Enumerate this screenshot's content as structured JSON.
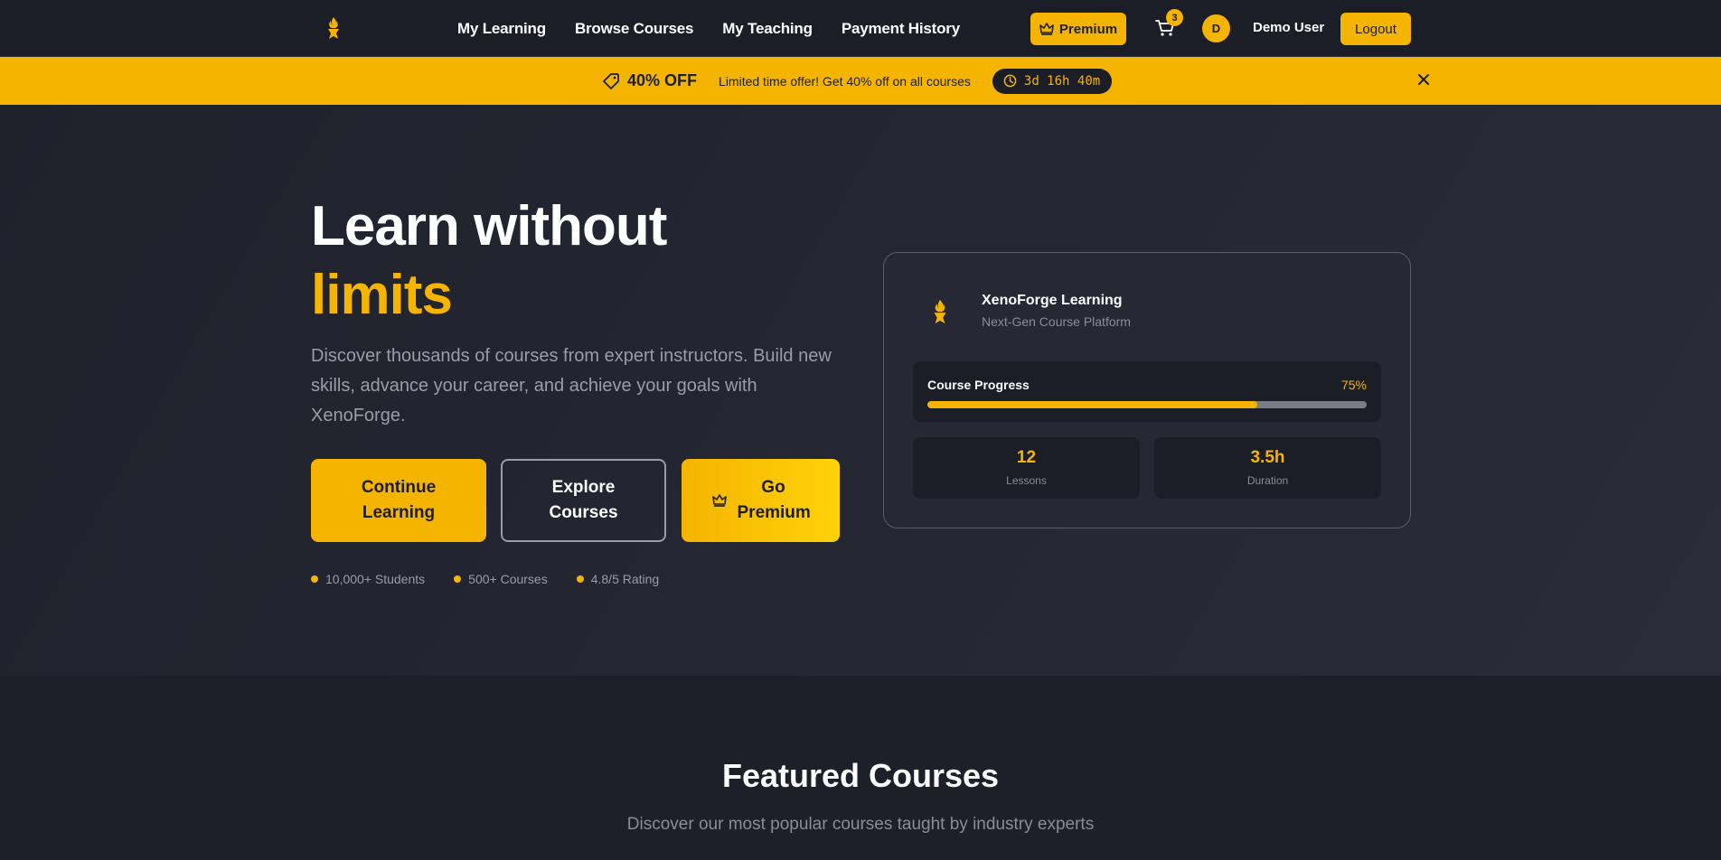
{
  "nav": {
    "links": [
      "My Learning",
      "Browse Courses",
      "My Teaching",
      "Payment History"
    ],
    "premium_label": "Premium",
    "cart_count": "3",
    "avatar_initial": "D",
    "username": "Demo User",
    "logout_label": "Logout"
  },
  "promo": {
    "off_label": "40% OFF",
    "text": "Limited time offer! Get 40% off on all courses",
    "timer": "3d 16h 40m"
  },
  "hero": {
    "title_line1": "Learn without",
    "title_line2": "limits",
    "description": "Discover thousands of courses from expert instructors. Build new skills, advance your career, and achieve your goals with XenoForge.",
    "cta_continue_line1": "Continue",
    "cta_continue_line2": "Learning",
    "cta_explore_line1": "Explore",
    "cta_explore_line2": "Courses",
    "cta_premium_line1": "Go",
    "cta_premium_line2": "Premium",
    "stats": [
      "10,000+ Students",
      "500+ Courses",
      "4.8/5 Rating"
    ]
  },
  "card": {
    "title": "XenoForge Learning",
    "subtitle": "Next-Gen Course Platform",
    "progress_label": "Course Progress",
    "progress_text": "75%",
    "progress_fraction": 0.75,
    "lessons_value": "12",
    "lessons_label": "Lessons",
    "duration_value": "3.5h",
    "duration_label": "Duration"
  },
  "featured": {
    "title": "Featured Courses",
    "subtitle": "Discover our most popular courses taught by industry experts"
  },
  "colors": {
    "accent": "#f5b400",
    "background": "#1e2029",
    "surface": "#262833",
    "muted_text": "#9a9ca8"
  },
  "icons": [
    "torch-logo-icon",
    "crown-icon",
    "cart-icon",
    "tag-icon",
    "clock-icon",
    "close-icon"
  ]
}
